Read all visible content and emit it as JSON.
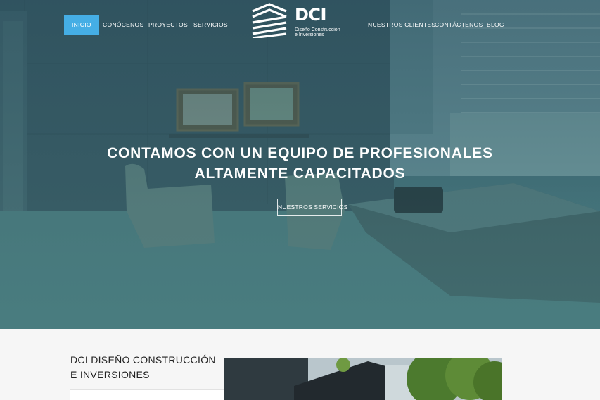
{
  "nav": {
    "left": [
      {
        "label": "INICIO",
        "active": true
      },
      {
        "label": "CONÓCENOS",
        "active": false
      },
      {
        "label": "PROYECTOS",
        "active": false
      },
      {
        "label": "SERVICIOS",
        "active": false
      }
    ],
    "right": [
      {
        "label": "NUESTROS CLIENTES"
      },
      {
        "label": "CONTÁCTENOS"
      },
      {
        "label": "BLOG"
      }
    ]
  },
  "logo": {
    "name": "DCI",
    "subtitle_line1": "Diseño Construcción",
    "subtitle_line2": "e Inversiones",
    "icon": "building-stripes-icon"
  },
  "hero": {
    "headline_line1": "CONTAMOS CON UN EQUIPO DE PROFESIONALES",
    "headline_line2": "ALTAMENTE CAPACITADOS",
    "button_label": "NUESTROS SERVICIOS"
  },
  "about": {
    "title_line1": "DCI DISEÑO CONSTRUCCIÓN",
    "title_line2": "E INVERSIONES"
  },
  "colors": {
    "accent": "#45aee5",
    "hero_tint": "#3f6770"
  }
}
